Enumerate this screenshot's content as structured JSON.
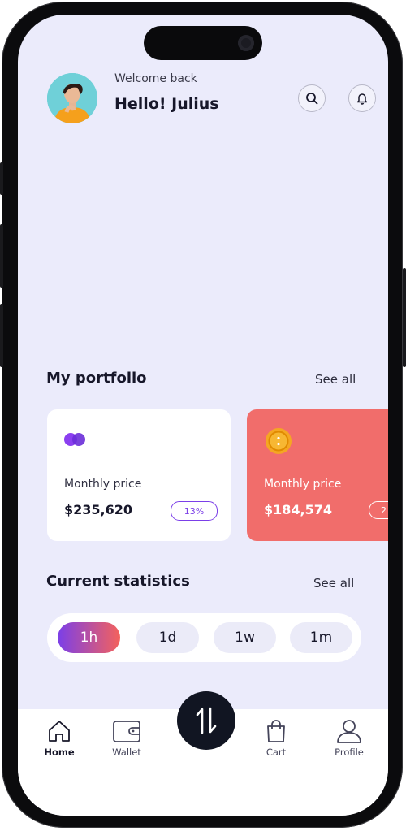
{
  "header": {
    "welcome": "Welcome back",
    "greeting": "Hello! Julius"
  },
  "portfolio": {
    "title": "My portfolio",
    "see_all": "See all",
    "cards": [
      {
        "label": "Monthly price",
        "price": "$235,620",
        "change": "13%",
        "background": "#ffffff",
        "accent": "#7b3fe8"
      },
      {
        "label": "Monthly price",
        "price": "$184,574",
        "change": "2",
        "background": "#f16d6b",
        "accent": "#f5a623"
      }
    ]
  },
  "statistics": {
    "title": "Current statistics",
    "see_all": "See all",
    "ranges": [
      "1h",
      "1d",
      "1w",
      "1m"
    ],
    "active_range": "1h"
  },
  "nav": {
    "items": [
      {
        "label": "Home",
        "icon": "home-icon",
        "active": true
      },
      {
        "label": "Wallet",
        "icon": "wallet-icon",
        "active": false
      },
      {
        "label": "Cart",
        "icon": "shopping-bag-icon",
        "active": false
      },
      {
        "label": "Profile",
        "icon": "user-icon",
        "active": false
      }
    ],
    "fab_icon": "swap-arrows-icon"
  },
  "colors": {
    "background": "#ebebfb",
    "accent_gradient_start": "#7b3fe8",
    "accent_gradient_end": "#f4625c",
    "coral": "#f16d6b",
    "dark": "#111522"
  }
}
